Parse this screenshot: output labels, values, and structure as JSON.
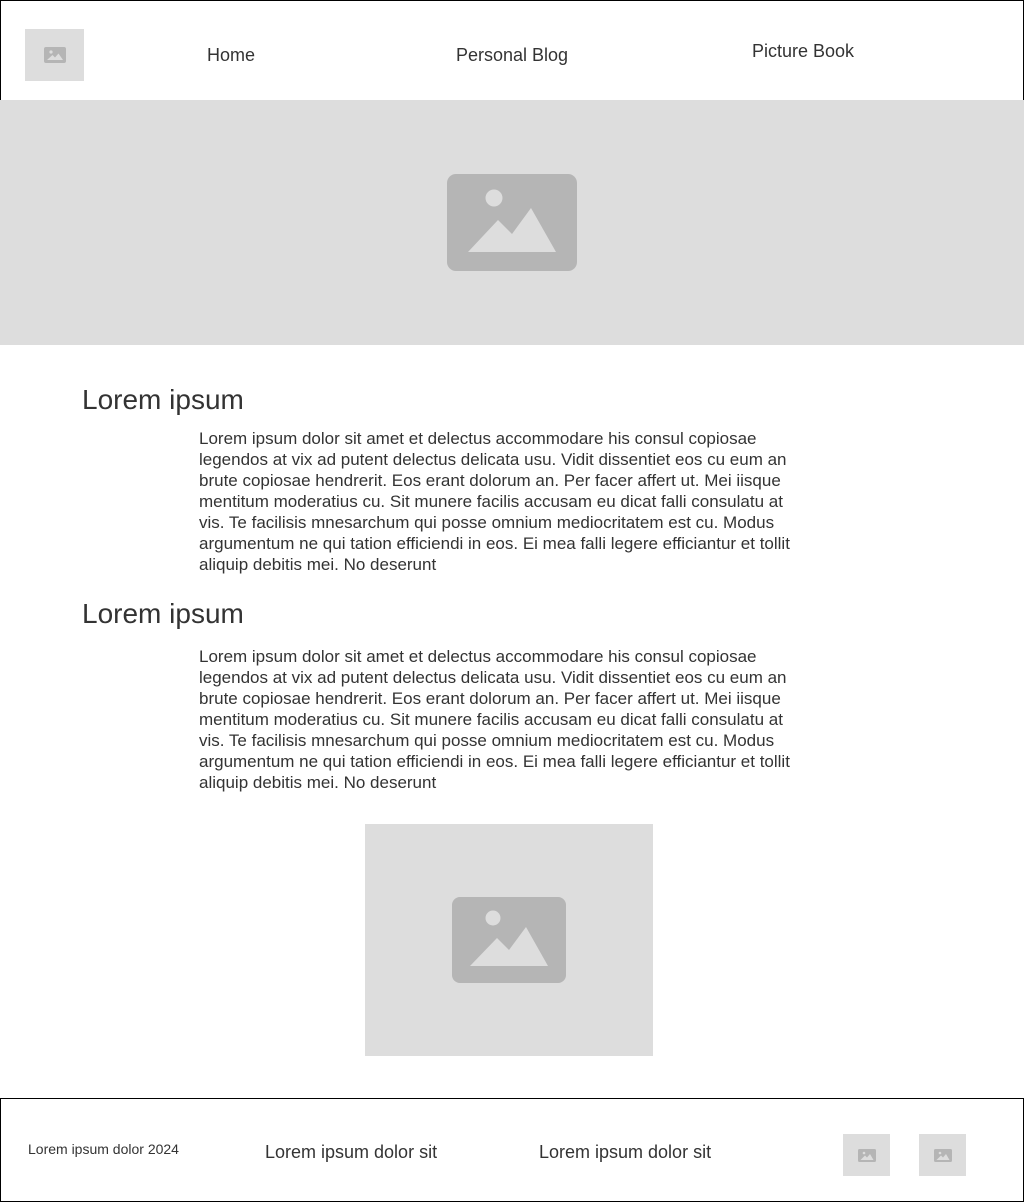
{
  "header": {
    "logo_icon": "image-placeholder-icon",
    "nav": {
      "home": "Home",
      "personal_blog": "Personal Blog",
      "picture_book": "Picture Book"
    }
  },
  "hero": {
    "icon": "image-placeholder-icon"
  },
  "sections": [
    {
      "heading": "Lorem ipsum",
      "body": "Lorem ipsum dolor sit amet et delectus accommodare his consul copiosae legendos at vix ad putent delectus delicata usu. Vidit dissentiet eos cu eum an brute copiosae hendrerit. Eos erant dolorum an. Per facer affert ut. Mei iisque mentitum moderatius cu. Sit munere facilis accusam eu dicat falli consulatu at vis. Te facilisis mnesarchum qui posse omnium mediocritatem est cu. Modus argumentum ne qui tation efficiendi in eos. Ei mea falli legere efficiantur et tollit aliquip debitis mei. No deserunt"
    },
    {
      "heading": "Lorem ipsum",
      "body": "Lorem ipsum dolor sit amet et delectus accommodare his consul copiosae legendos at vix ad putent delectus delicata usu. Vidit dissentiet eos cu eum an brute copiosae hendrerit. Eos erant dolorum an. Per facer affert ut. Mei iisque mentitum moderatius cu. Sit munere facilis accusam eu dicat falli consulatu at vis. Te facilisis mnesarchum qui posse omnium mediocritatem est cu. Modus argumentum ne qui tation efficiendi in eos. Ei mea falli legere efficiantur et tollit aliquip debitis mei. No deserunt"
    }
  ],
  "content_image": {
    "icon": "image-placeholder-icon"
  },
  "footer": {
    "copyright": "Lorem ipsum dolor 2024",
    "link_1": "Lorem ipsum dolor sit",
    "link_2": "Lorem ipsum dolor sit",
    "social_icons": [
      "image-placeholder-icon",
      "image-placeholder-icon"
    ]
  },
  "colors": {
    "placeholder_bg": "#dddddd",
    "placeholder_icon": "#b5b5b5",
    "text": "#333333",
    "border": "#000000"
  }
}
